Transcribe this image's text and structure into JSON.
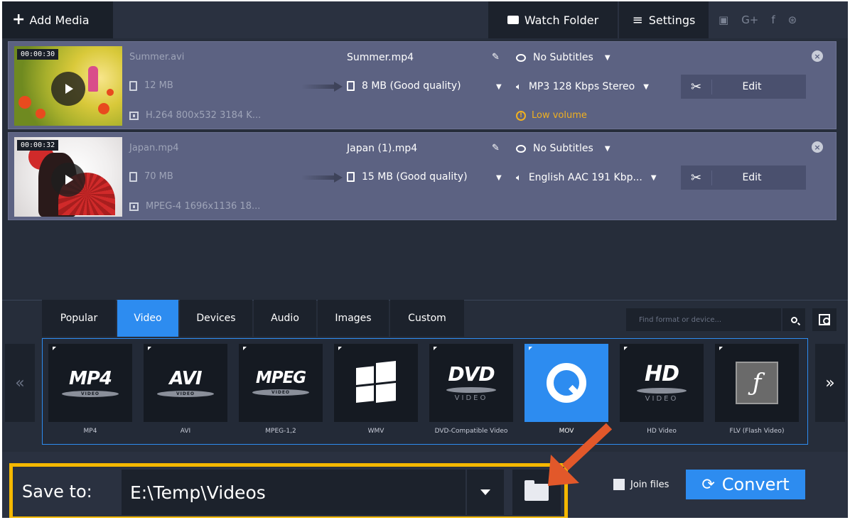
{
  "topbar": {
    "add_media": "Add Media",
    "watch_folder": "Watch Folder",
    "settings": "Settings",
    "social": [
      "youtube-icon",
      "google-plus-icon",
      "facebook-icon",
      "vk-icon"
    ]
  },
  "files": [
    {
      "timecode": "00:00:30",
      "src_name": "Summer.avi",
      "src_size": "12 MB",
      "src_codec": "H.264 800x532 3184 K...",
      "dst_name": "Summer.mp4",
      "dst_size": "8 MB (Good quality)",
      "subtitles": "No Subtitles",
      "audio": "MP3 128 Kbps Stereo",
      "warning": "Low volume",
      "edit": "Edit"
    },
    {
      "timecode": "00:00:32",
      "src_name": "Japan.mp4",
      "src_size": "70 MB",
      "src_codec": "MPEG-4 1696x1136 18...",
      "dst_name": "Japan (1).mp4",
      "dst_size": "15 MB (Good quality)",
      "subtitles": "No Subtitles",
      "audio": "English AAC 191 Kbp...",
      "edit": "Edit"
    }
  ],
  "tabs": [
    "Popular",
    "Video",
    "Devices",
    "Audio",
    "Images",
    "Custom"
  ],
  "active_tab": "Video",
  "search": {
    "placeholder": "Find format or device..."
  },
  "formats": [
    {
      "logo": "MP4",
      "sub": "VIDEO",
      "label": "MP4"
    },
    {
      "logo": "AVI",
      "sub": "VIDEO",
      "label": "AVI"
    },
    {
      "logo": "MPEG",
      "sub": "VIDEO",
      "label": "MPEG-1,2"
    },
    {
      "logo": "",
      "sub": "",
      "label": "WMV"
    },
    {
      "logo": "DVD",
      "sub": "VIDEO",
      "label": "DVD-Compatible Video"
    },
    {
      "logo": "",
      "sub": "",
      "label": "MOV"
    },
    {
      "logo": "HD",
      "sub": "VIDEO",
      "label": "HD Video"
    },
    {
      "logo": "",
      "sub": "",
      "label": "FLV (Flash Video)"
    }
  ],
  "selected_format": "MOV",
  "bottom": {
    "save_label": "Save to:",
    "save_path": "E:\\Temp\\Videos",
    "join_files": "Join files",
    "convert": "Convert"
  },
  "colors": {
    "accent": "#2d8cf0",
    "highlight": "#f5b800",
    "annotation_arrow": "#e2582a",
    "warning": "#f0b020",
    "row_bg": "#5c6282"
  }
}
